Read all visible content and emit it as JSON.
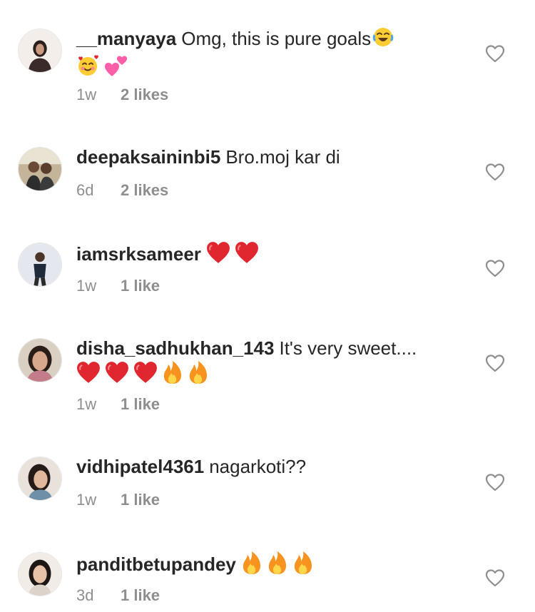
{
  "comments": [
    {
      "username": "__manyaya",
      "text": "Omg, this is pure goals",
      "time": "1w",
      "likes": "2 likes"
    },
    {
      "username": "deepaksaininbi5",
      "text": "Bro.moj kar di",
      "time": "6d",
      "likes": "2 likes"
    },
    {
      "username": "iamsrksameer",
      "text": "",
      "time": "1w",
      "likes": "1 like"
    },
    {
      "username": "disha_sadhukhan_143",
      "text": "It's very sweet....",
      "time": "1w",
      "likes": "1 like"
    },
    {
      "username": "vidhipatel4361",
      "text": "nagarkoti??",
      "time": "1w",
      "likes": "1 like"
    },
    {
      "username": "panditbetupandey",
      "text": "",
      "time": "3d",
      "likes": "1 like"
    }
  ],
  "icons": {
    "like": "heart-outline-icon",
    "emoji_laugh": "face-with-tears-of-joy",
    "emoji_smile_hearts": "smiling-face-with-hearts",
    "emoji_pink_hearts": "two-hearts",
    "emoji_red_heart": "red-heart",
    "emoji_fire": "fire"
  },
  "colors": {
    "username": "#262626",
    "meta": "#8e8e8e",
    "heart_outline": "#8e8e8e",
    "red_heart": "#e0262f",
    "fire": "#f7931e"
  }
}
